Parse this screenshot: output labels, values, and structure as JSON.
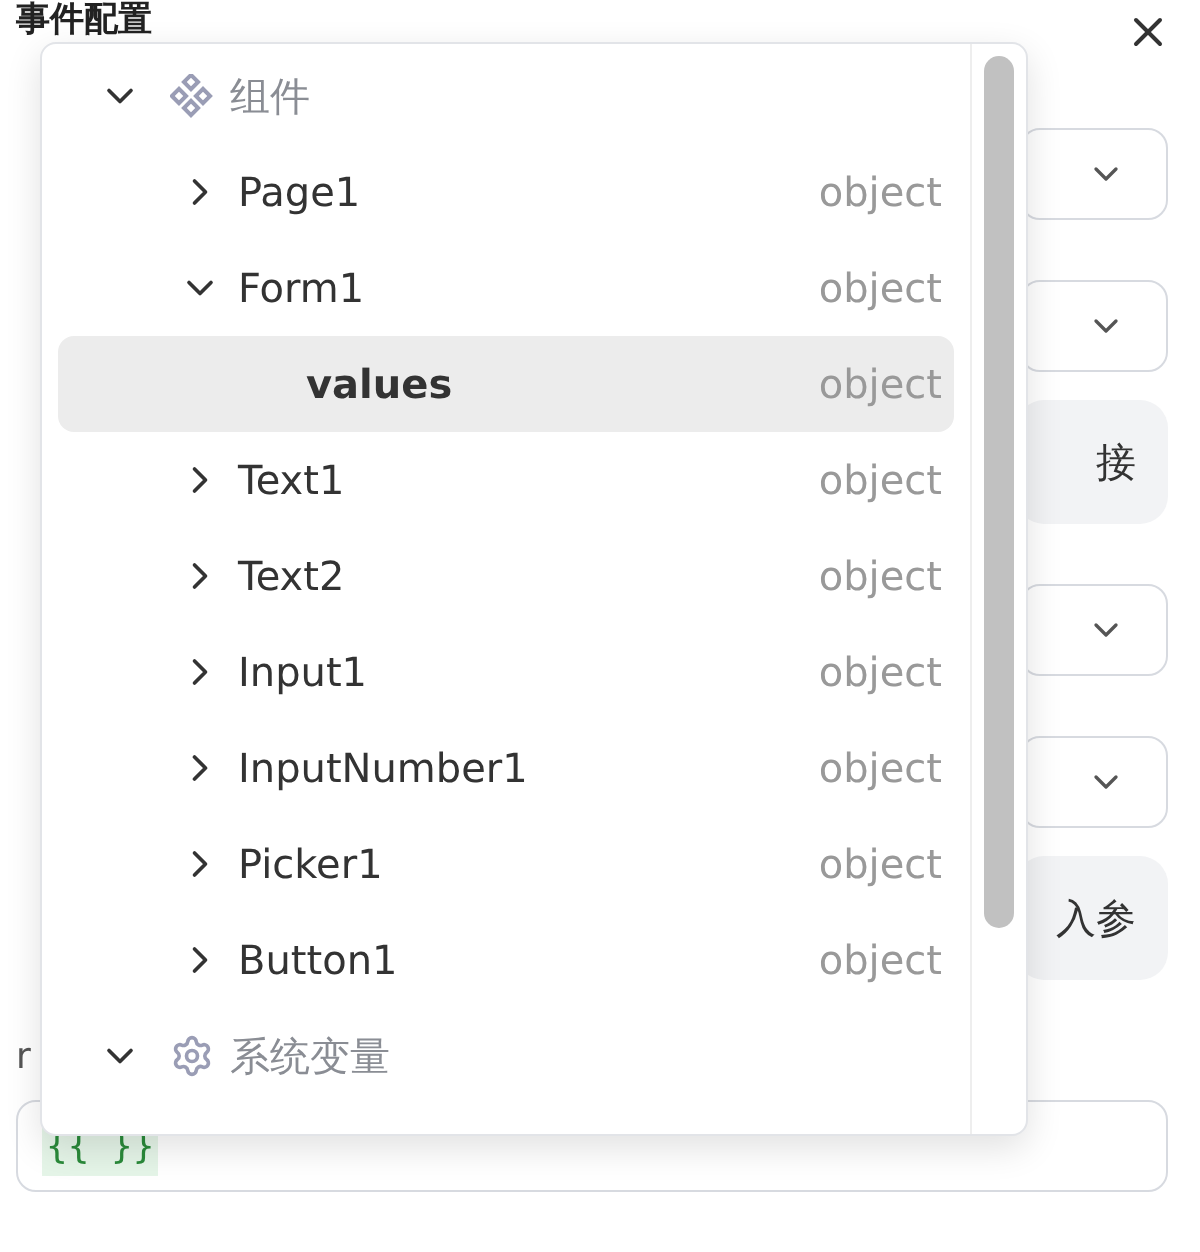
{
  "panel": {
    "title": "事件配置",
    "label": "r",
    "controls": [
      {
        "kind": "select"
      },
      {
        "kind": "select"
      },
      {
        "kind": "button",
        "label": "接"
      },
      {
        "kind": "select"
      },
      {
        "kind": "select"
      },
      {
        "kind": "button",
        "label": "入参"
      }
    ],
    "code_field": {
      "value": "{{ }}"
    }
  },
  "popover": {
    "groups": [
      {
        "label": "组件",
        "kind": "components",
        "expanded": true,
        "children": [
          {
            "label": "Page1",
            "type": "object",
            "expanded": false,
            "selected": false
          },
          {
            "label": "Form1",
            "type": "object",
            "expanded": true,
            "selected": false,
            "children": [
              {
                "label": "values",
                "type": "object",
                "selected": true
              }
            ]
          },
          {
            "label": "Text1",
            "type": "object",
            "expanded": false,
            "selected": false
          },
          {
            "label": "Text2",
            "type": "object",
            "expanded": false,
            "selected": false
          },
          {
            "label": "Input1",
            "type": "object",
            "expanded": false,
            "selected": false
          },
          {
            "label": "InputNumber1",
            "type": "object",
            "expanded": false,
            "selected": false
          },
          {
            "label": "Picker1",
            "type": "object",
            "expanded": false,
            "selected": false
          },
          {
            "label": "Button1",
            "type": "object",
            "expanded": false,
            "selected": false
          }
        ]
      },
      {
        "label": "系统变量",
        "kind": "settings",
        "expanded": true
      }
    ]
  }
}
